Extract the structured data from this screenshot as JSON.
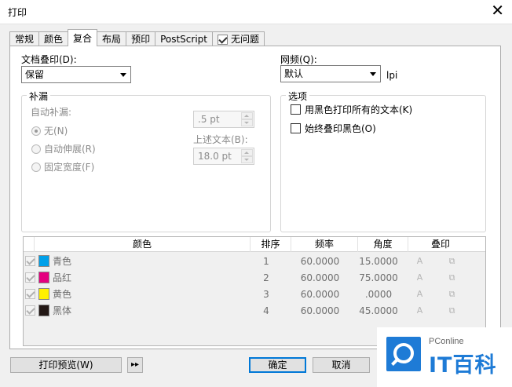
{
  "window": {
    "title": "打印",
    "close_glyph": "✕"
  },
  "tabs": [
    {
      "label": "常规",
      "active": false
    },
    {
      "label": "颜色",
      "active": false
    },
    {
      "label": "复合",
      "active": true
    },
    {
      "label": "布局",
      "active": false
    },
    {
      "label": "预印",
      "active": false
    },
    {
      "label": "PostScript",
      "active": false
    },
    {
      "label": "无问题",
      "active": false,
      "icon": "checkmark-icon"
    }
  ],
  "overprint": {
    "label": "文档叠印(D):",
    "value": "保留"
  },
  "screen": {
    "label": "网频(Q):",
    "value": "默认",
    "unit": "lpi"
  },
  "trap": {
    "legend": "补漏",
    "auto_label": "自动补漏:",
    "options": [
      {
        "label": "无(N)",
        "selected": true
      },
      {
        "label": "自动伸展(R)",
        "selected": false
      },
      {
        "label": "固定宽度(F)",
        "selected": false
      }
    ],
    "value_top": ".5 pt",
    "above_text_label": "上述文本(B):",
    "value_bottom": "18.0 pt"
  },
  "options": {
    "legend": "选项",
    "items": [
      {
        "label": "用黑色打印所有的文本(K)",
        "checked": false
      },
      {
        "label": "始终叠印黑色(O)",
        "checked": false
      }
    ]
  },
  "table": {
    "headers": [
      "颜色",
      "排序",
      "频率",
      "角度",
      "叠印"
    ],
    "rows": [
      {
        "name": "青色",
        "color": "#00a0e9",
        "order": "1",
        "frequency": "60.0000",
        "angle": "15.0000"
      },
      {
        "name": "品红",
        "color": "#e4007f",
        "order": "2",
        "frequency": "60.0000",
        "angle": "75.0000"
      },
      {
        "name": "黄色",
        "color": "#fff100",
        "order": "3",
        "frequency": "60.0000",
        "angle": ".0000"
      },
      {
        "name": "黑体",
        "color": "#231815",
        "order": "4",
        "frequency": "60.0000",
        "angle": "45.0000"
      }
    ]
  },
  "buttons": {
    "preview": "打印预览(W)",
    "expand": "▸▸",
    "ok": "确定",
    "cancel": "取消"
  },
  "watermark": {
    "top": "PConline",
    "big": "IT百科"
  }
}
